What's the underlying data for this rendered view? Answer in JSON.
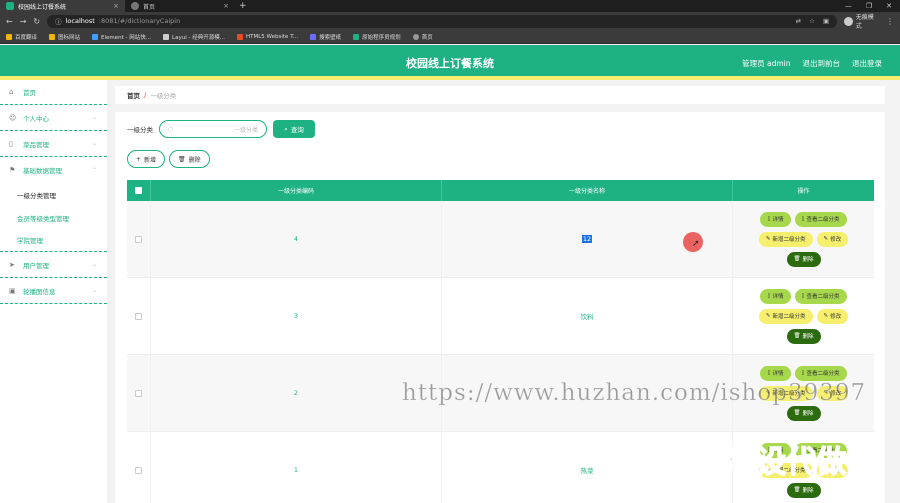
{
  "browser": {
    "tabs": [
      {
        "label": "校园线上订餐系统",
        "active": true
      },
      {
        "label": "首页",
        "active": false
      }
    ],
    "url_host": "localhost",
    "url_path": ":8081/#/dictionaryCaipin",
    "profile": "无痕模式",
    "bookmarks": [
      "百度翻译",
      "图标网站",
      "Element - 网站快...",
      "Layui - 经典开源模...",
      "HTML5 Website T...",
      "搜索壁纸",
      "原始程序员规划",
      "首页"
    ]
  },
  "header": {
    "title": "校园线上订餐系统",
    "admin": "管理员 admin",
    "back": "退出到前台",
    "logout": "退出登录"
  },
  "sidebar": {
    "items": [
      {
        "label": "首页",
        "icon": "home-icon"
      },
      {
        "label": "个人中心",
        "icon": "user-icon"
      },
      {
        "label": "菜品管理",
        "icon": "document-icon"
      },
      {
        "label": "基础数据管理",
        "icon": "flag-icon"
      }
    ],
    "sub_items": [
      "一级分类管理",
      "会员等级类型管理",
      "学院管理"
    ],
    "items_after": [
      {
        "label": "用户管理",
        "icon": "send-icon"
      },
      {
        "label": "轮播图信息",
        "icon": "image-icon"
      }
    ]
  },
  "breadcrumb": {
    "home": "首页",
    "sep": "/",
    "current": "一级分类"
  },
  "search": {
    "label": "一级分类",
    "placeholder": "一级分类",
    "button": "查询"
  },
  "actions": {
    "add": "新增",
    "delete": "删除"
  },
  "table": {
    "headers": [
      "一级分类编码",
      "一级分类名称",
      "操作"
    ],
    "rows": [
      {
        "code": "4",
        "name": "12"
      },
      {
        "code": "3",
        "name": "饮料"
      },
      {
        "code": "2",
        "name": ""
      },
      {
        "code": "1",
        "name": "热菜"
      }
    ],
    "ops": {
      "detail": "详情",
      "view_sub": "查看二级分类",
      "add_sub": "新增二级分类",
      "edit": "修改",
      "delete": "删除"
    }
  },
  "watermark": {
    "url": "https://www.huzhan.com/ishop39397",
    "cn": "毕设代做"
  },
  "colors": {
    "primary": "#1db184",
    "yellow": "#f6ef6d",
    "lime": "#a7d84c",
    "dark_green": "#2d6b10"
  }
}
